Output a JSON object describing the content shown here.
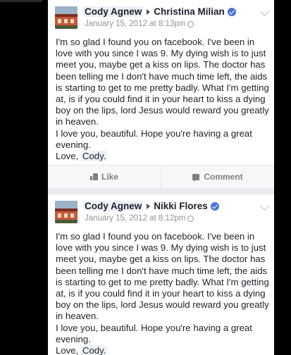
{
  "posts": [
    {
      "author": "Cody Agnew",
      "recipient": "Christina Milian",
      "timestamp": "January 15, 2012 at 8:13pm",
      "body_lines": [
        "I'm so glad I found you on facebook. I've been in love with you since I was 9. My dying wish is to just meet you, maybe get a kiss on lips. The doctor has been telling me I don't have much time left, the aids is starting to get to me pretty badly. What I'm getting at, is if you could find it in your heart to kiss a dying boy on the lips, lord Jesus would reward you greatly in heaven.",
        "I love you, beautiful. Hope you're having a great evening."
      ],
      "signoff": "Love,",
      "signature": "Cody.",
      "like_label": "Like",
      "comment_label": "Comment"
    },
    {
      "author": "Cody Agnew",
      "recipient": "Nikki Flores",
      "timestamp": "January 15, 2012 at 8:12pm",
      "body_lines": [
        "I'm so glad I found you on facebook. I've been in love with you since I was 9. My dying wish is to just meet you, maybe get a kiss on lips. The doctor has been telling me I don't have much time left, the aids is starting to get to me pretty badly. What I'm getting at, is if you could find it in your heart to kiss a dying boy on the lips, lord Jesus would reward you greatly in heaven.",
        "I love you, beautiful. Hope you're having a great evening."
      ],
      "signoff": "Love,",
      "signature": "Cody."
    }
  ],
  "icons": {
    "verified": "verified-badge-icon",
    "arrow": "arrow-right-icon",
    "audience": "globe-icon",
    "menu": "chevron-down-icon",
    "like": "thumbs-up-icon",
    "comment": "comment-icon"
  },
  "colors": {
    "verified_blue": "#4a76d6",
    "text": "#1d2129",
    "meta": "#90949c",
    "feed_bg": "#e9ebee"
  }
}
